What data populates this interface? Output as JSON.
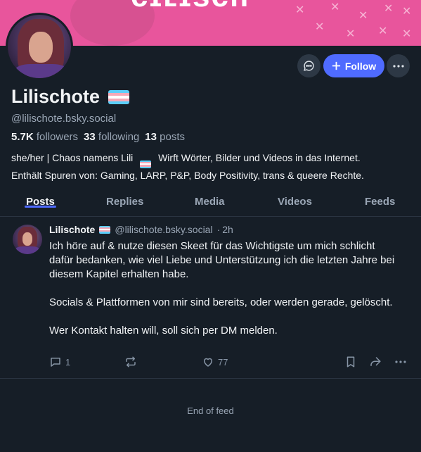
{
  "profile": {
    "display_name": "Lilischote",
    "handle": "@lilischote.bsky.social",
    "followers_count": "5.7K",
    "followers_label": "followers",
    "following_count": "33",
    "following_label": "following",
    "posts_count": "13",
    "posts_label": "posts",
    "bio_line1": "she/her | Chaos namens Lili",
    "bio_line1_rest": "Wirft Wörter, Bilder und Videos in das Internet.",
    "bio_line2": "Enthält Spuren von: Gaming, LARP, P&P, Body Positivity, trans & queere Rechte.",
    "flag_colors": [
      "#5bcefa",
      "#f5a9b8",
      "#ffffff",
      "#f5a9b8",
      "#5bcefa"
    ]
  },
  "actions": {
    "follow_label": "Follow",
    "message_icon": "chat-bubble-icon",
    "more_icon": "ellipsis-icon"
  },
  "tabs": [
    {
      "label": "Posts",
      "active": true
    },
    {
      "label": "Replies",
      "active": false
    },
    {
      "label": "Media",
      "active": false
    },
    {
      "label": "Videos",
      "active": false
    },
    {
      "label": "Feeds",
      "active": false
    }
  ],
  "post": {
    "author": "Lilischote",
    "handle": "@lilischote.bsky.social",
    "separator": "·",
    "time": "2h",
    "paragraphs": [
      "Ich höre auf & nutze diesen Skeet für das Wichtigste um mich schlicht dafür bedanken, wie viel Liebe und Unterstützung ich die letzten Jahre bei diesem Kapitel erhalten habe.",
      "Socials & Plattformen von mir sind bereits, oder werden gerade, gelöscht.",
      "Wer Kontakt halten will, soll sich per DM melden."
    ],
    "reply_count": "1",
    "like_count": "77"
  },
  "feed_end_text": "End of feed",
  "colors": {
    "background": "#161e27",
    "accent": "#4f6bff",
    "banner": "#e8559c",
    "muted_text": "#9aa6b5"
  }
}
